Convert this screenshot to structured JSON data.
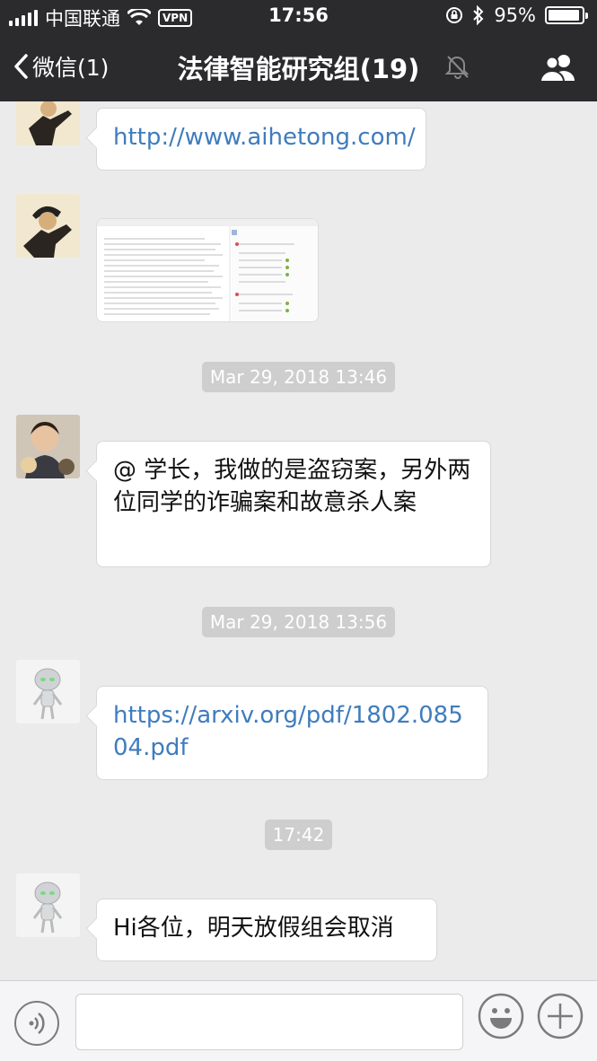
{
  "status_bar": {
    "carrier": "中国联通",
    "vpn": "VPN",
    "time": "17:56",
    "battery_text": "95%",
    "battery_level": 0.95
  },
  "nav": {
    "back_label": "微信(1)",
    "title": "法律智能研究组(19)"
  },
  "messages": {
    "m1": {
      "text": "http://www.aihetong.com/"
    },
    "s1": "Mar 29, 2018 13:46",
    "m3": {
      "text": "@            学长，我做的是盗窃案，另外两位同学的诈骗案和故意杀人案"
    },
    "s2": "Mar 29, 2018 13:56",
    "m4": {
      "text": "https://arxiv.org/pdf/1802.08504.pdf"
    },
    "s3": "17:42",
    "m5": {
      "text": "Hi各位，明天放假组会取消"
    }
  },
  "input": {
    "placeholder": ""
  },
  "colors": {
    "nav_bg": "#2b2b2e",
    "chat_bg": "#ebebeb",
    "link": "#3f7cbd",
    "stamp_bg": "#cecece"
  }
}
